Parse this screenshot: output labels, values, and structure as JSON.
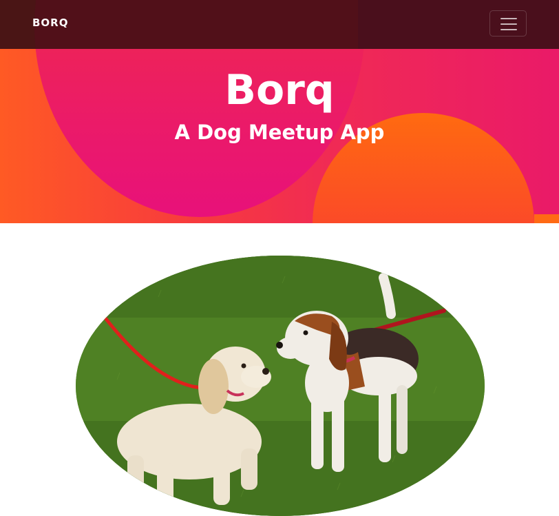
{
  "navbar": {
    "brand": "BORQ",
    "toggler_icon": "hamburger-menu-icon"
  },
  "hero": {
    "title": "Borq",
    "subtitle": "A Dog Meetup App",
    "colors": {
      "orange": "#ff5a24",
      "pink": "#e8117a",
      "nav": "#4a1515"
    }
  },
  "photo": {
    "subject": "two-dogs-on-grass"
  }
}
